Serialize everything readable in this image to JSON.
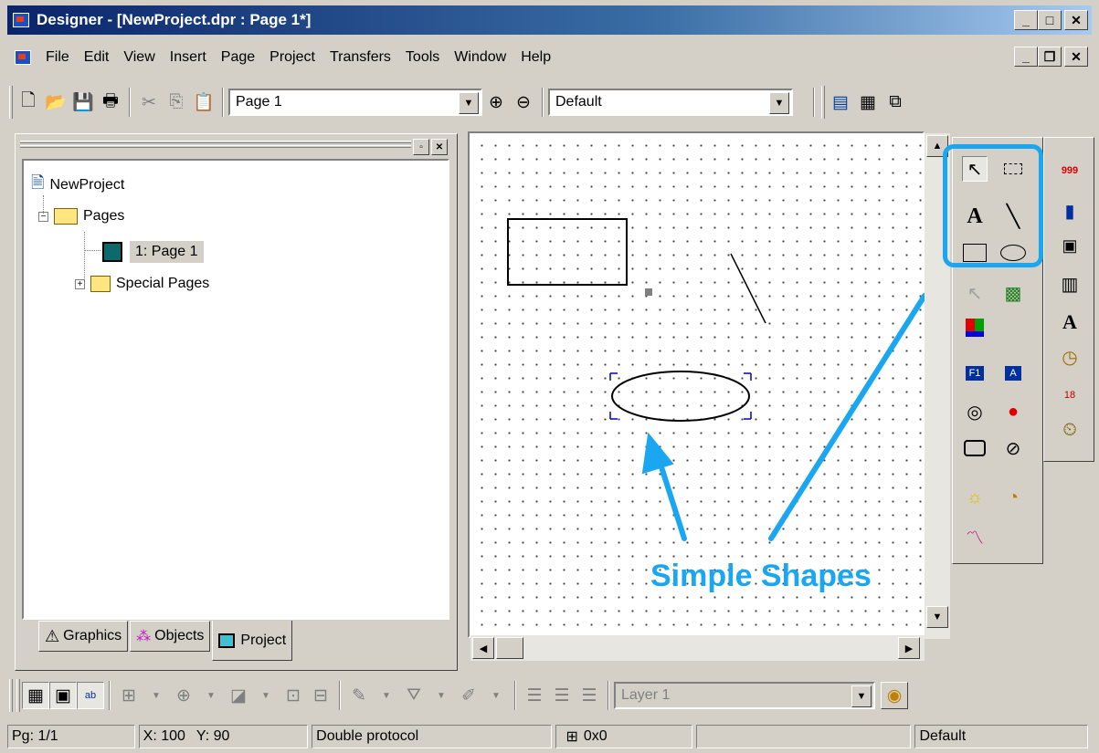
{
  "window": {
    "title": "Designer - [NewProject.dpr : Page 1*]"
  },
  "menu": [
    "File",
    "Edit",
    "View",
    "Insert",
    "Page",
    "Project",
    "Transfers",
    "Tools",
    "Window",
    "Help"
  ],
  "toolbar": {
    "page_combo": "Page 1",
    "style_combo": "Default"
  },
  "tree": {
    "root": "NewProject",
    "pages": "Pages",
    "page1": "1: Page 1",
    "special": "Special Pages"
  },
  "tabs": {
    "graphics": "Graphics",
    "objects": "Objects",
    "project": "Project"
  },
  "bottom": {
    "layer_combo": "Layer 1"
  },
  "status": {
    "page": "Pg: 1/1",
    "x": "X: 100",
    "y": "Y: 90",
    "protocol": "Double protocol",
    "size": "0x0",
    "style": "Default"
  },
  "annotation": {
    "label": "Simple Shapes",
    "color": "#1aa6f0"
  }
}
